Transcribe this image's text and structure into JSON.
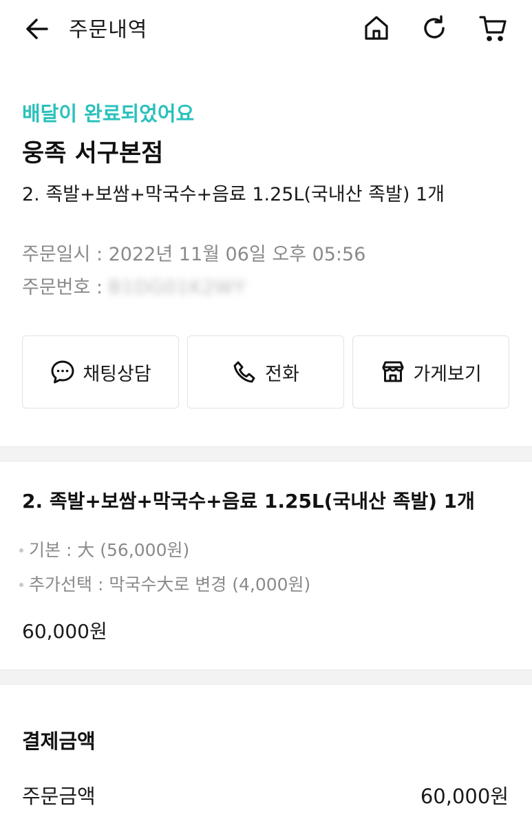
{
  "header": {
    "title": "주문내역",
    "icons": [
      "back-arrow-icon",
      "home-icon",
      "refresh-icon",
      "cart-icon"
    ]
  },
  "order": {
    "status": "배달이 완료되었어요",
    "store_name": "웅족 서구본점",
    "menu_summary": "2. 족발+보쌈+막국수+음료 1.25L(국내산 족발) 1개",
    "date_label": "주문일시 : ",
    "date_value": "2022년 11월 06일 오후 05:56",
    "number_label": "주문번호 : ",
    "number_value": "B1DG01K2WY"
  },
  "actions": {
    "chat_label": "채팅상담",
    "call_label": "전화",
    "store_label": "가게보기"
  },
  "menu_detail": {
    "name": "2. 족발+보쌈+막국수+음료 1.25L(국내산 족발) 1개",
    "options": [
      "기본 : 大 (56,000원)",
      "추가선택 : 막국수大로 변경 (4,000원)"
    ],
    "price": "60,000원"
  },
  "payment": {
    "title": "결제금액",
    "order_amount_label": "주문금액",
    "order_amount_value": "60,000원"
  },
  "colors": {
    "accent": "#2ac1bc",
    "text": "#1a1a1a",
    "muted": "#8a8a8a",
    "divider": "#f3f3f3"
  }
}
